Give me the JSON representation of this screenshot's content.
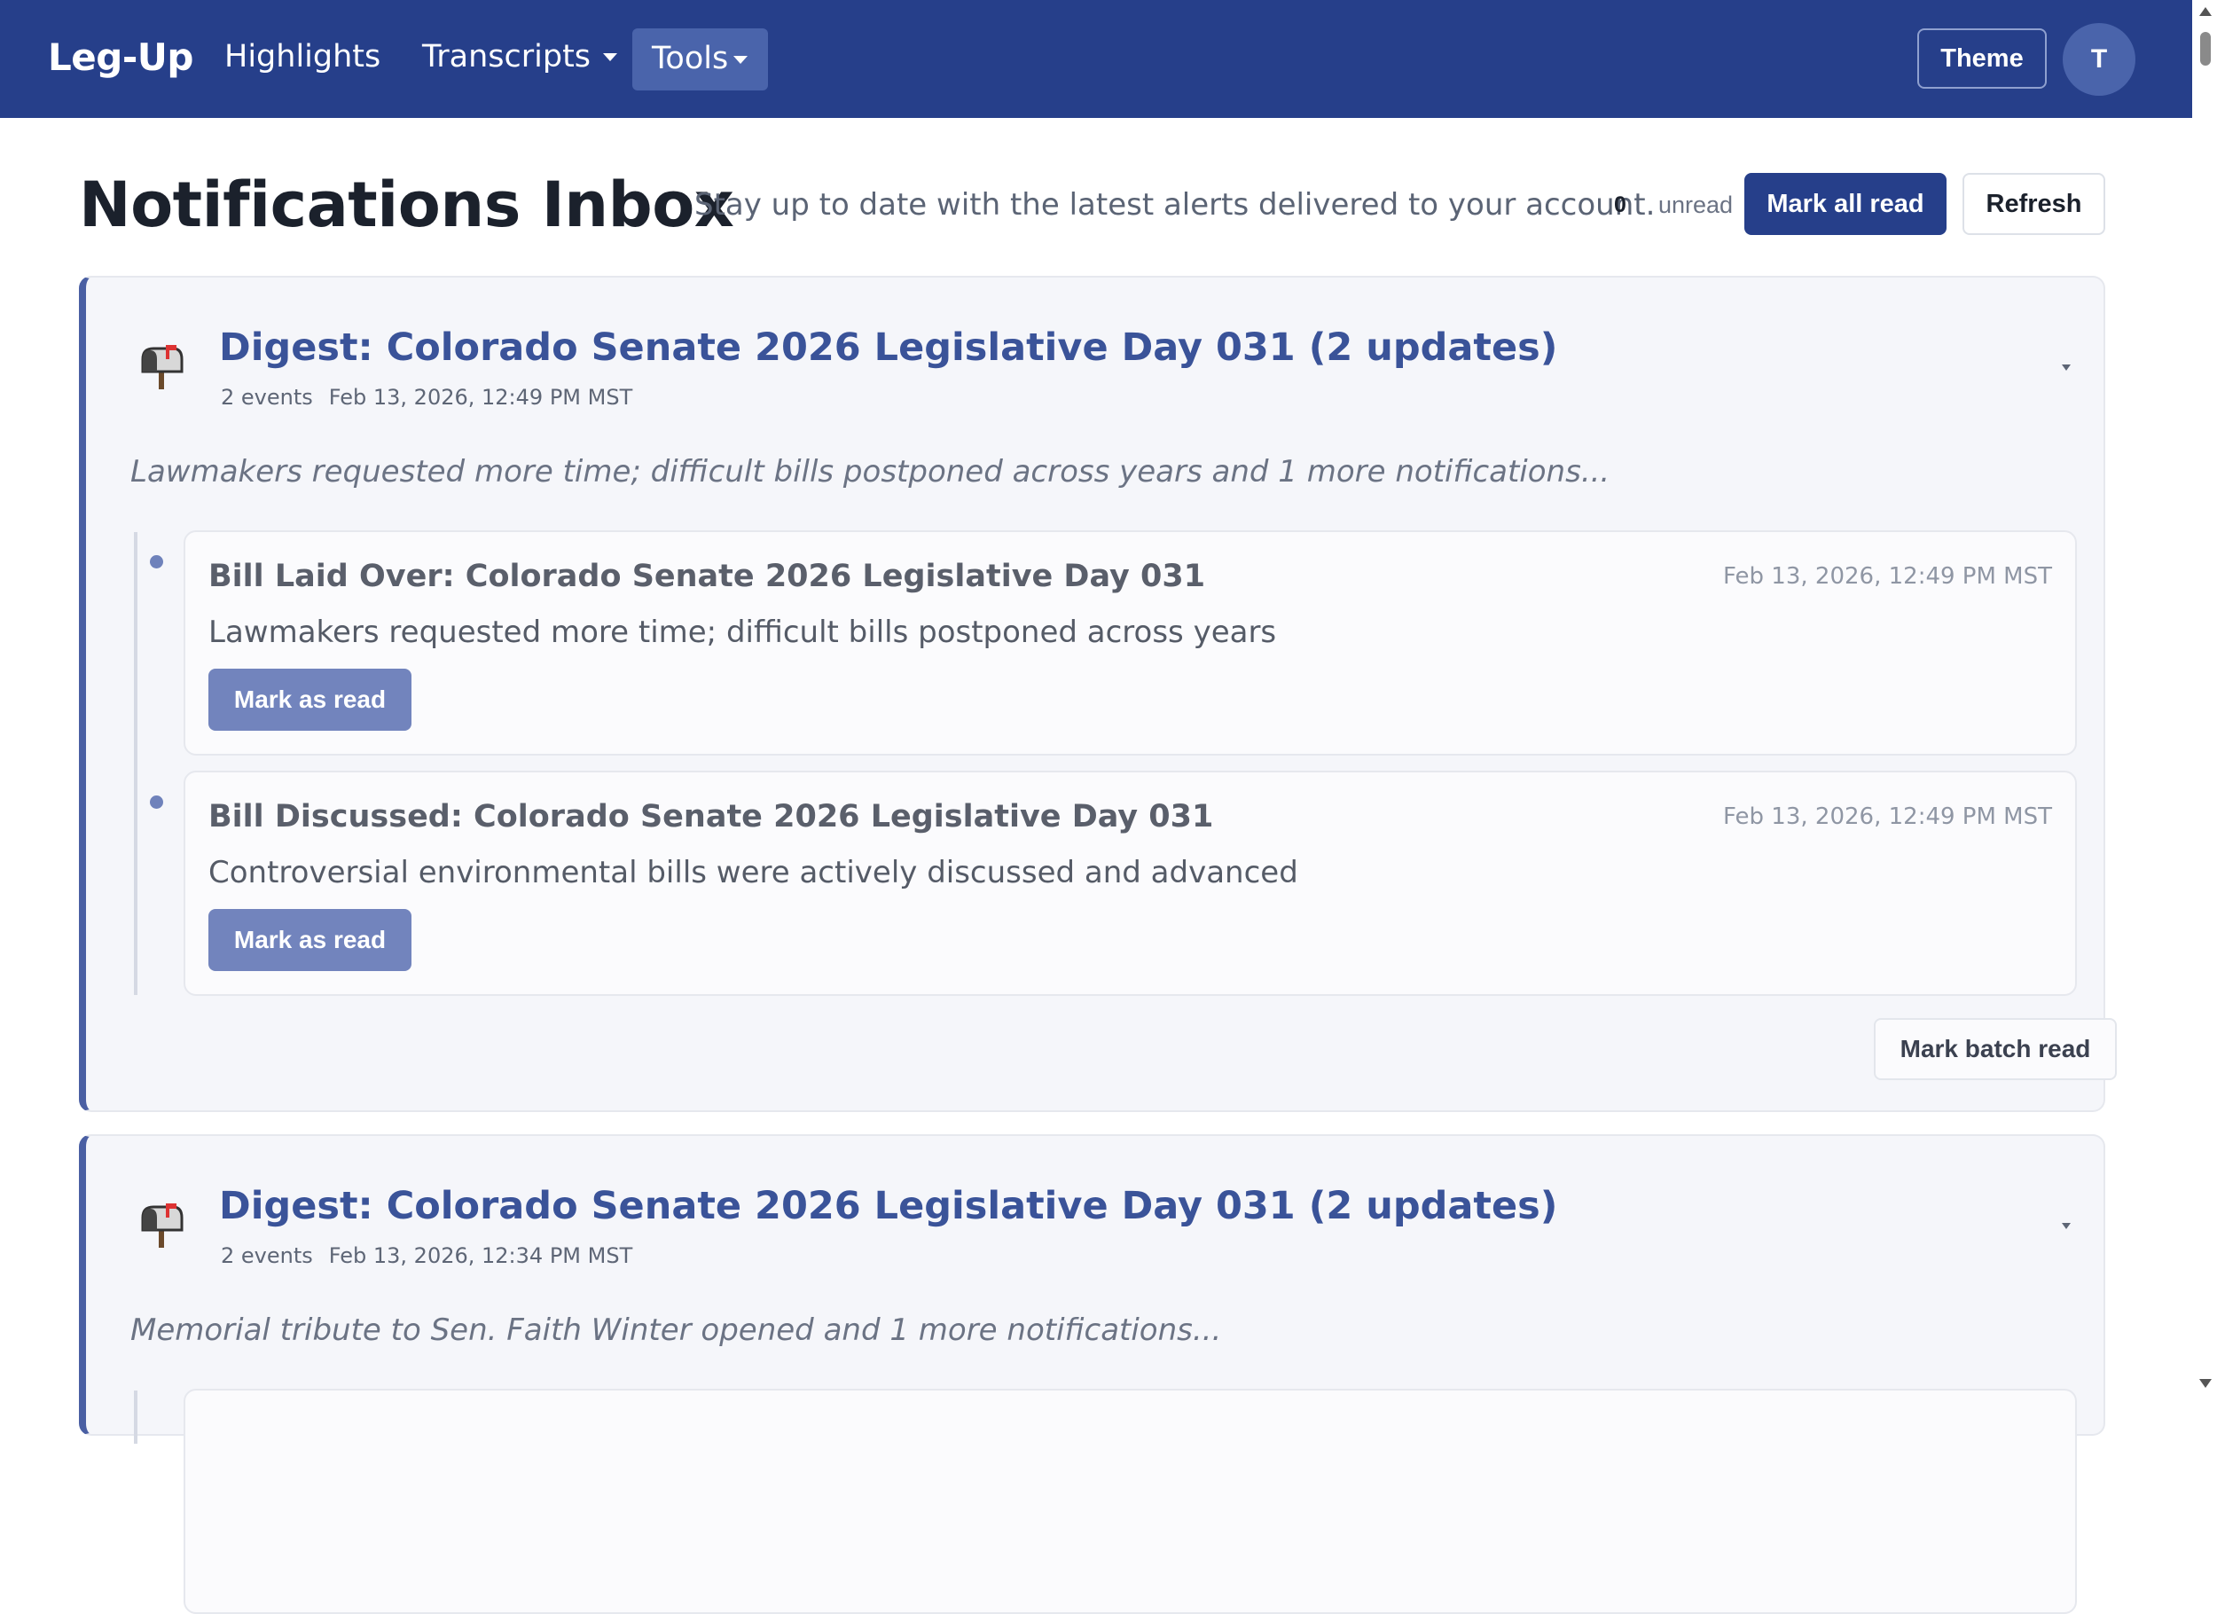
{
  "nav": {
    "brand": "Leg-Up",
    "links": [
      "Highlights",
      "Transcripts",
      "Tools"
    ],
    "theme_label": "Theme",
    "avatar_initial": "T",
    "bar_color": "#263f8a"
  },
  "header": {
    "title": "Notifications Inbox",
    "subtitle": "Stay up to date with the latest alerts delivered to your account.",
    "unread_count": "0",
    "unread_label": "unread",
    "mark_all_label": "Mark all read",
    "refresh_label": "Refresh"
  },
  "digests": [
    {
      "icon": "mailbox-icon",
      "title": "Digest: Colorado Senate 2026 Legislative Day 031 (2 updates)",
      "events_count": "2 events",
      "time": "Feb 13, 2026, 12:49 PM MST",
      "summary": "Lawmakers requested more time; difficult bills postponed across years and 1 more notifications...",
      "events": [
        {
          "title": "Bill Laid Over: Colorado Senate 2026 Legislative Day 031",
          "time": "Feb 13, 2026, 12:49 PM MST",
          "body": "Lawmakers requested more time; difficult bills postponed across years",
          "button": "Mark as read"
        },
        {
          "title": "Bill Discussed: Colorado Senate 2026 Legislative Day 031",
          "time": "Feb 13, 2026, 12:49 PM MST",
          "body": "Controversial environmental bills were actively discussed and advanced",
          "button": "Mark as read"
        }
      ],
      "batch_label": "Mark batch read"
    },
    {
      "icon": "mailbox-icon",
      "title": "Digest: Colorado Senate 2026 Legislative Day 031 (2 updates)",
      "events_count": "2 events",
      "time": "Feb 13, 2026, 12:34 PM MST",
      "summary": "Memorial tribute to Sen. Faith Winter opened and 1 more notifications..."
    }
  ]
}
